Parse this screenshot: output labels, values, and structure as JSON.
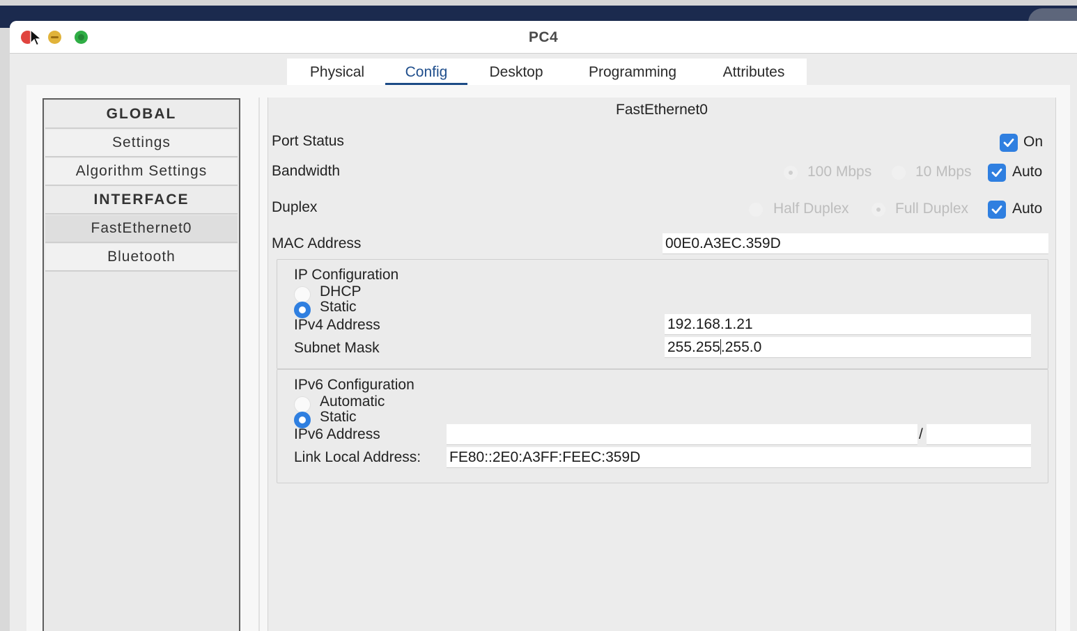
{
  "window": {
    "title": "PC4"
  },
  "tabs": [
    {
      "label": "Physical",
      "active": false
    },
    {
      "label": "Config",
      "active": true
    },
    {
      "label": "Desktop",
      "active": false
    },
    {
      "label": "Programming",
      "active": false
    },
    {
      "label": "Attributes",
      "active": false
    }
  ],
  "sidebar": {
    "items": [
      {
        "label": "GLOBAL",
        "kind": "header"
      },
      {
        "label": "Settings",
        "kind": "item"
      },
      {
        "label": "Algorithm Settings",
        "kind": "item"
      },
      {
        "label": "INTERFACE",
        "kind": "header"
      },
      {
        "label": "FastEthernet0",
        "kind": "item",
        "selected": true
      },
      {
        "label": "Bluetooth",
        "kind": "item"
      }
    ]
  },
  "interface": {
    "title": "FastEthernet0",
    "port_status": {
      "label": "Port Status",
      "on_label": "On",
      "checked": true
    },
    "bandwidth": {
      "label": "Bandwidth",
      "options": [
        "100 Mbps",
        "10 Mbps"
      ],
      "selected": "100 Mbps",
      "auto_label": "Auto",
      "auto_checked": true
    },
    "duplex": {
      "label": "Duplex",
      "options": [
        "Half Duplex",
        "Full Duplex"
      ],
      "selected": "Full Duplex",
      "auto_label": "Auto",
      "auto_checked": true
    },
    "mac": {
      "label": "MAC Address",
      "value": "00E0.A3EC.359D"
    },
    "ipv4": {
      "heading": "IP Configuration",
      "dhcp_label": "DHCP",
      "static_label": "Static",
      "mode": "Static",
      "address_label": "IPv4 Address",
      "address": "192.168.1.21",
      "mask_label": "Subnet Mask",
      "mask_before_caret": "255.255",
      "mask_after_caret": ".255.0"
    },
    "ipv6": {
      "heading": "IPv6 Configuration",
      "auto_label": "Automatic",
      "static_label": "Static",
      "mode": "Static",
      "address_label": "IPv6 Address",
      "address": "",
      "prefix_separator": "/",
      "prefix": "",
      "link_local_label": "Link Local Address:",
      "link_local": "FE80::2E0:A3FF:FEEC:359D"
    }
  },
  "colors": {
    "accent": "#2f7fe0",
    "tab_underline": "#1c4b86",
    "close": "#e0443e",
    "minimize": "#e1b33a",
    "maximize": "#2fae45"
  }
}
